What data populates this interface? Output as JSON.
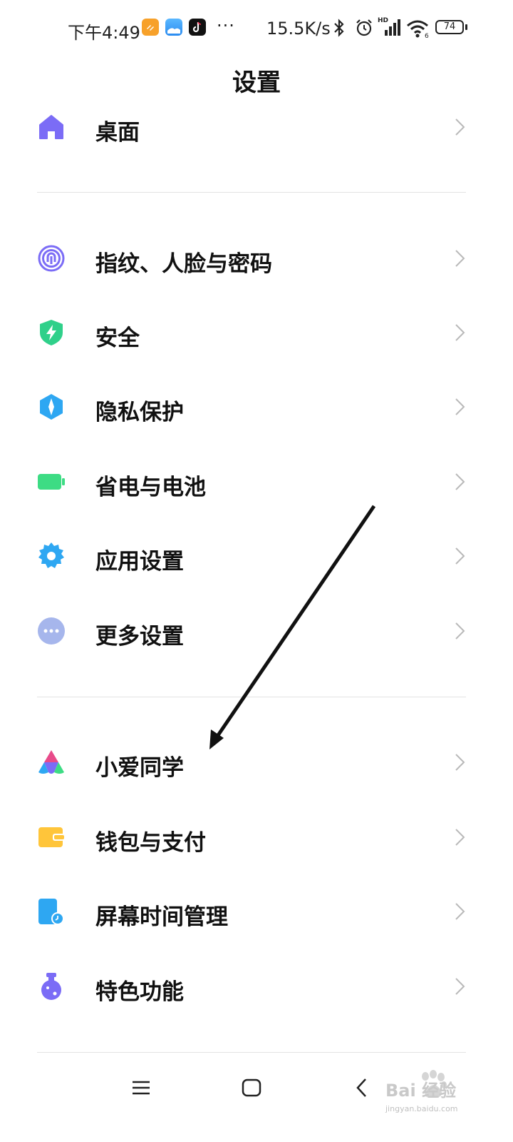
{
  "status_bar": {
    "time": "下午4:49",
    "more": "···",
    "net_speed": "15.5K/s",
    "battery": "74"
  },
  "header": {
    "title": "设置"
  },
  "menu": {
    "items": [
      {
        "label": "桌面",
        "icon": "home-icon",
        "color": "#7b6cf6"
      },
      {
        "label": "指纹、人脸与密码",
        "icon": "fingerprint-icon",
        "color": "#7b6cf6"
      },
      {
        "label": "安全",
        "icon": "shield-bolt-icon",
        "color": "#2fd08a"
      },
      {
        "label": "隐私保护",
        "icon": "privacy-icon",
        "color": "#2ea7f2"
      },
      {
        "label": "省电与电池",
        "icon": "battery-icon",
        "color": "#3ddc84"
      },
      {
        "label": "应用设置",
        "icon": "gear-icon",
        "color": "#2ea7f2"
      },
      {
        "label": "更多设置",
        "icon": "more-dots-icon",
        "color": "#a6b6ec"
      },
      {
        "label": "小爱同学",
        "icon": "xiaoai-icon",
        "color": "#e84b8a"
      },
      {
        "label": "钱包与支付",
        "icon": "wallet-icon",
        "color": "#ffc53a"
      },
      {
        "label": "屏幕时间管理",
        "icon": "screen-time-icon",
        "color": "#2ea7f2"
      },
      {
        "label": "特色功能",
        "icon": "flask-icon",
        "color": "#7b6cf6"
      }
    ]
  },
  "watermark": {
    "text": "Bai 经验",
    "sub": "jingyan.baidu.com"
  }
}
